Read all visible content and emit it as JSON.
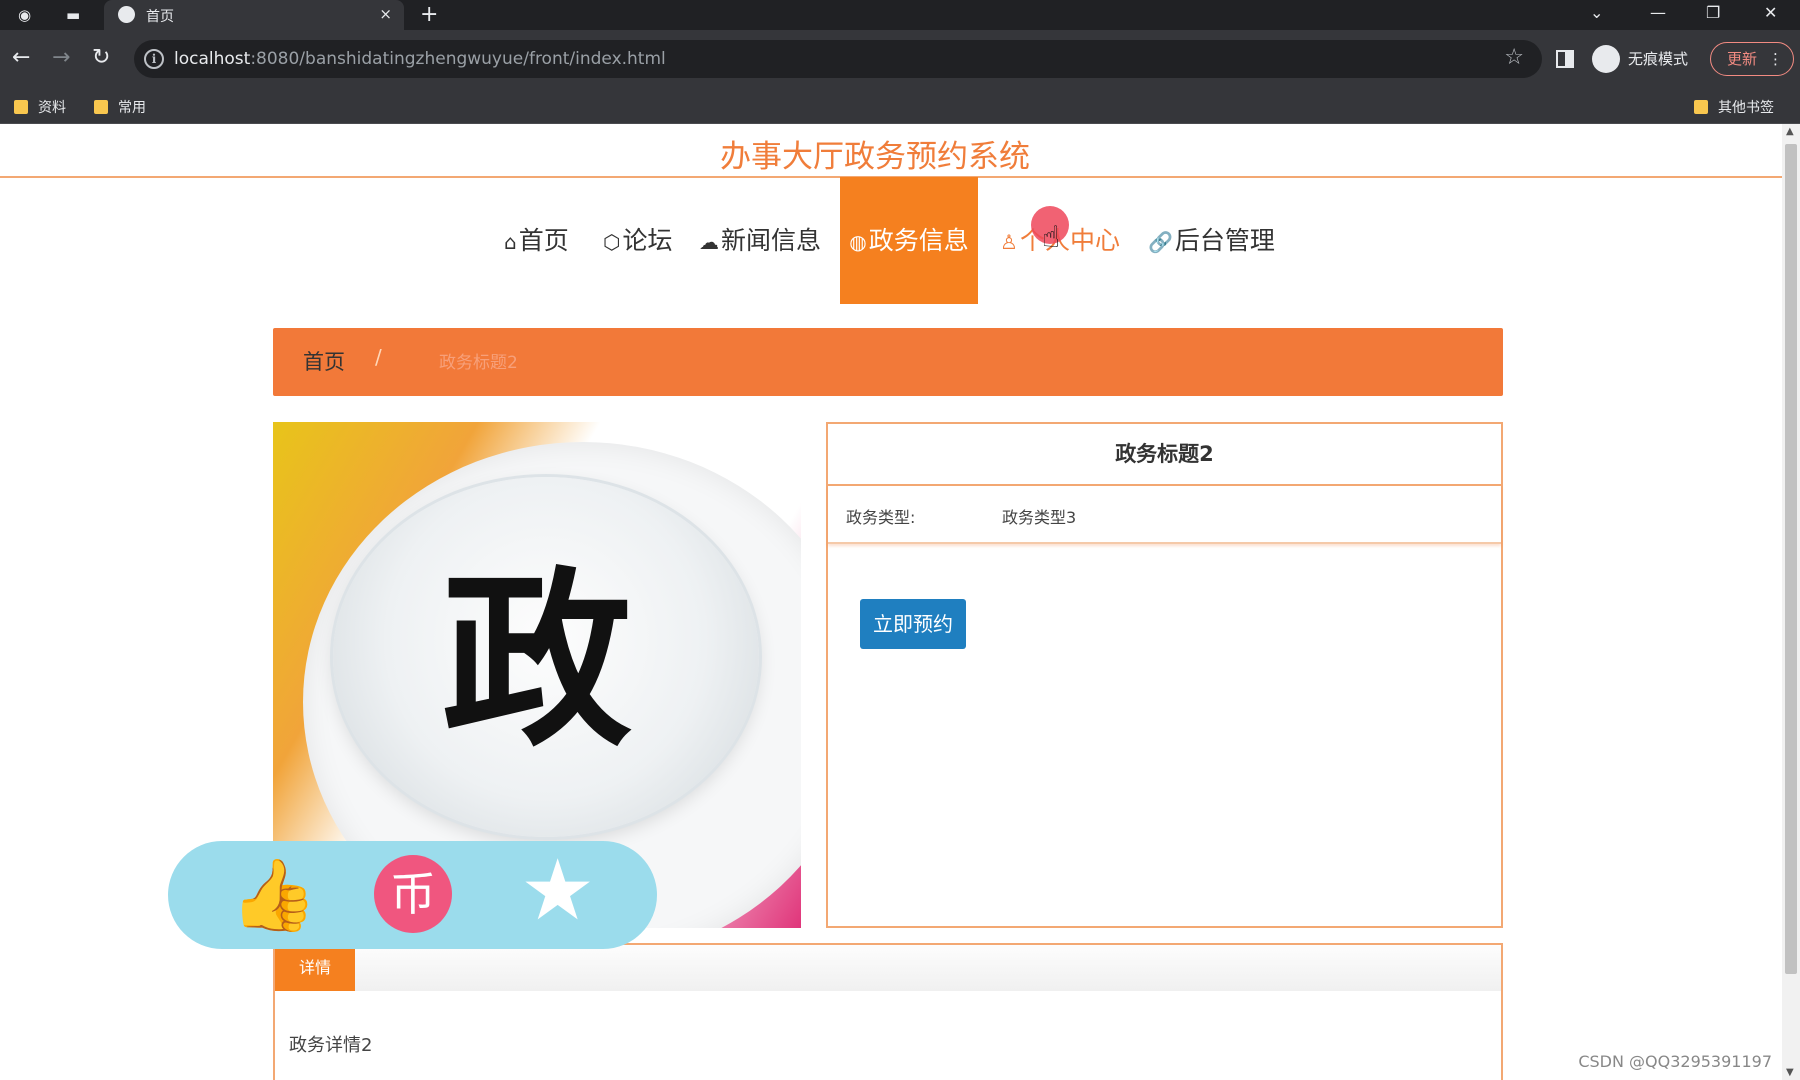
{
  "browser": {
    "tab_title": "首页",
    "tab_close": "×",
    "new_tab": "+",
    "url_host": "localhost",
    "url_rest": ":8080/banshidatingzhengwuyue/front/index.html",
    "incognito_label": "无痕模式",
    "update_label": "更新",
    "bookmarks": [
      "资料",
      "常用"
    ],
    "other_bookmarks": "其他书签"
  },
  "site": {
    "title": "办事大厅政务预约系统"
  },
  "nav": {
    "items": [
      {
        "icon": "⌂",
        "label": "首页"
      },
      {
        "icon": "⬡",
        "label": "论坛"
      },
      {
        "icon": "☁",
        "label": "新闻信息"
      },
      {
        "icon": "◍",
        "label": "政务信息"
      },
      {
        "icon": "♙",
        "label": "个人中心"
      },
      {
        "icon": "🔗",
        "label": "后台管理"
      }
    ],
    "active_index": 3
  },
  "breadcrumb": {
    "home": "首页",
    "separator": "/",
    "current": "政务标题2"
  },
  "photo": {
    "char": "政"
  },
  "detail": {
    "title": "政务标题2",
    "type_label": "政务类型:",
    "type_value": "政务类型3",
    "book_button": "立即预约"
  },
  "actions": {
    "like_icon": "thumbs-up-icon",
    "coin_icon": "coin-icon",
    "coin_glyph": "币",
    "favorite_icon": "star-icon"
  },
  "details_section": {
    "tab_label": "详情",
    "body": "政务详情2"
  },
  "watermark": "CSDN @QQ3295391197",
  "colors": {
    "accent_orange": "#f5801f",
    "title_orange": "#f07d3a",
    "button_blue": "#1f7fc0",
    "pill_cyan": "#9bdcec",
    "pink": "#f0567f"
  }
}
